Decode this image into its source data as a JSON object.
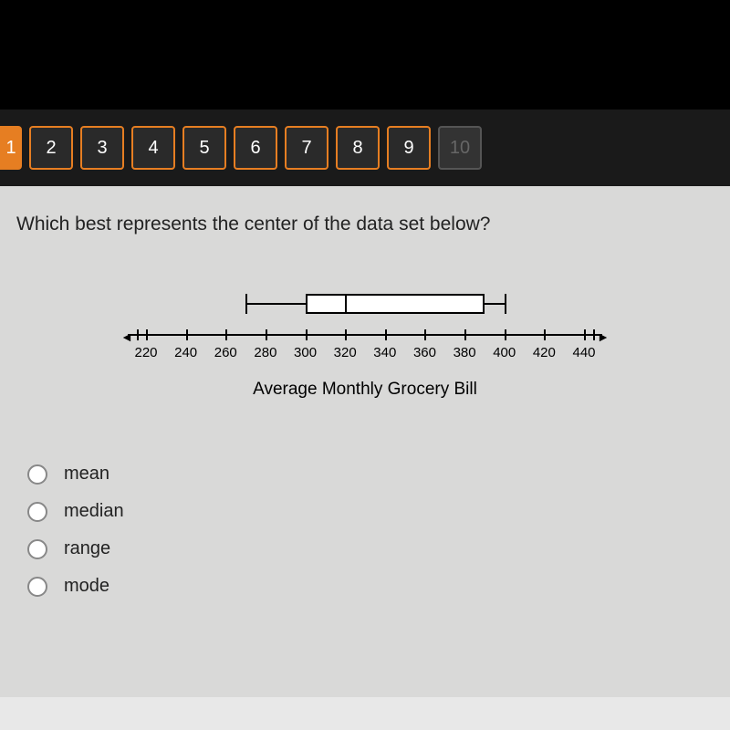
{
  "nav": {
    "items": [
      {
        "label": "1",
        "state": "active-partial"
      },
      {
        "label": "2",
        "state": "normal"
      },
      {
        "label": "3",
        "state": "normal"
      },
      {
        "label": "4",
        "state": "normal"
      },
      {
        "label": "5",
        "state": "normal"
      },
      {
        "label": "6",
        "state": "normal"
      },
      {
        "label": "7",
        "state": "normal"
      },
      {
        "label": "8",
        "state": "normal"
      },
      {
        "label": "9",
        "state": "normal"
      },
      {
        "label": "10",
        "state": "disabled"
      }
    ]
  },
  "question": "Which best represents the center of the data set below?",
  "chart_data": {
    "type": "boxplot",
    "title": "Average Monthly Grocery Bill",
    "axis_ticks": [
      220,
      240,
      260,
      280,
      300,
      320,
      340,
      360,
      380,
      400,
      420,
      440
    ],
    "axis_min": 220,
    "axis_max": 440,
    "min": 270,
    "q1": 300,
    "median": 320,
    "q3": 390,
    "max": 400
  },
  "options": [
    {
      "label": "mean"
    },
    {
      "label": "median"
    },
    {
      "label": "range"
    },
    {
      "label": "mode"
    }
  ]
}
